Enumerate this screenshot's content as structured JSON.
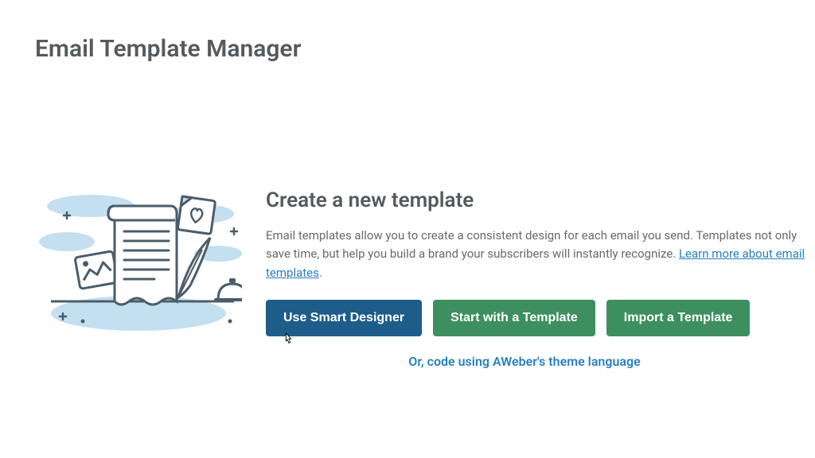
{
  "page": {
    "title": "Email Template Manager"
  },
  "section": {
    "heading": "Create a new template",
    "description_prefix": "Email templates allow you to create a consistent design for each email you send. Templates not only save time, but help you build a brand your subscribers will instantly recognize. ",
    "learn_more_label": "Learn more about email templates",
    "description_suffix": "."
  },
  "buttons": {
    "primary": "Use Smart Designer",
    "template": "Start with a Template",
    "import": "Import a Template"
  },
  "alt_link": "Or, code using AWeber's theme language"
}
